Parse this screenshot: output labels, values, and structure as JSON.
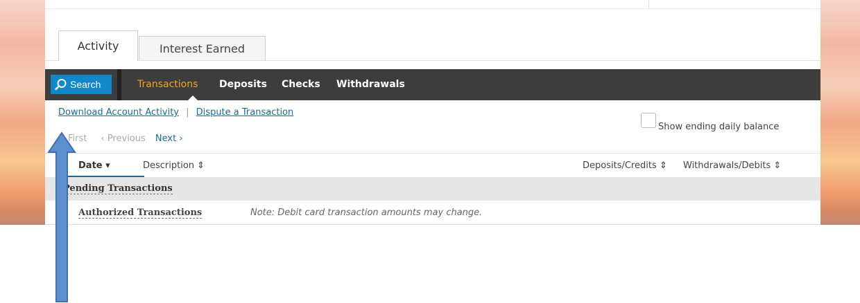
{
  "tabs": [
    {
      "label": "Activity",
      "active": true
    },
    {
      "label": "Interest Earned",
      "active": false
    }
  ],
  "toolbar": {
    "search_label": "Search",
    "nav": [
      "Transactions",
      "Deposits",
      "Checks",
      "Withdrawals"
    ],
    "active_nav": "Transactions"
  },
  "links": {
    "download": "Download Account Activity",
    "separator": "|",
    "dispute": "Dispute a Transaction"
  },
  "balance_option": {
    "label": "Show ending daily balance",
    "checked": false
  },
  "pager": {
    "first": "First",
    "previous": "‹ Previous",
    "next": "Next ›"
  },
  "columns": {
    "date": "Date ▾",
    "description": "Description ⇕",
    "credits": "Deposits/Credits ⇕",
    "debits": "Withdrawals/Debits ⇕"
  },
  "sections": {
    "pending": "Pending Transactions",
    "authorized": "Authorized Transactions",
    "authorized_note": "Note: Debit card transaction amounts may change."
  },
  "colors": {
    "accent_blue": "#1188c9",
    "link_blue": "#1a6b9a",
    "active_nav": "#f2a51c",
    "toolbar_bg": "#3d3d3d",
    "arrow_blue": "#5b8fd0"
  },
  "icons": {
    "search": "search-icon",
    "arrow": "up-arrow-annotation-icon"
  }
}
